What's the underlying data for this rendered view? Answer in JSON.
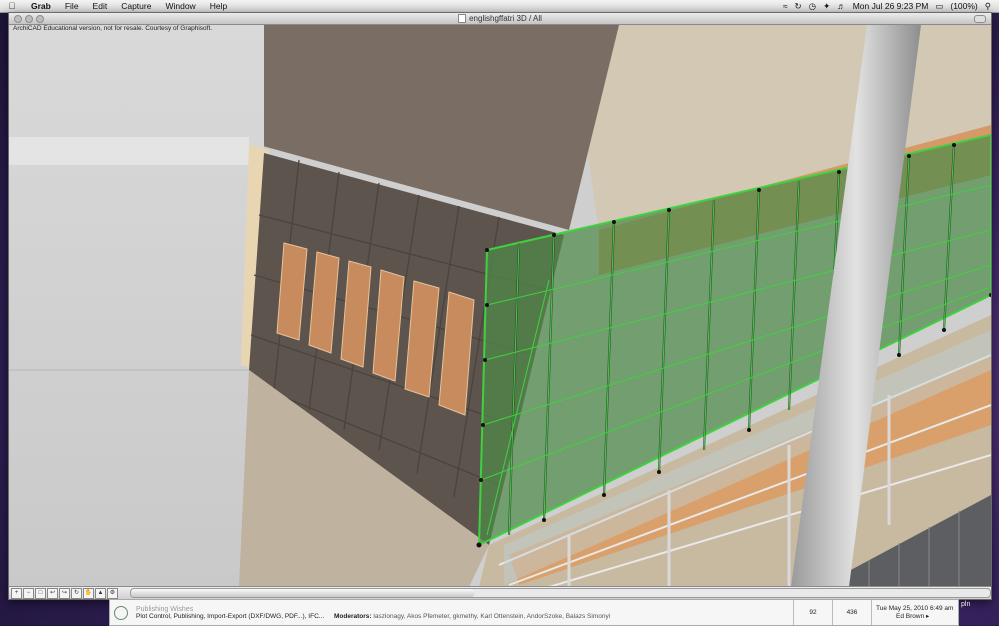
{
  "menubar": {
    "apple_icon": "apple-icon",
    "items": [
      {
        "label": "Grab",
        "bold": true
      },
      {
        "label": "File"
      },
      {
        "label": "Edit"
      },
      {
        "label": "Capture"
      },
      {
        "label": "Window"
      },
      {
        "label": "Help"
      }
    ],
    "battery": "(100%)",
    "clock": "Mon Jul 26  9:23 PM"
  },
  "window": {
    "title": "englishgffatri 3D / All",
    "watermark": "ArchiCAD Educational version, not for resale. Courtesy of Graphisoft."
  },
  "forum": {
    "forum_name": "Publishing Wishes",
    "forum_desc": "Plot Control, Publishing, Import-Export (DXF/DWG, PDF...), IFC...",
    "moderators_label": "Moderators:",
    "moderators": "laszlonagy, Akos Pfemeter, gkmethy, Karl Ottenstein, AndorSzoke, Balazs Simonyi",
    "topics": "92",
    "posts": "436",
    "last_post_date": "Tue May 25, 2010 6:49 am",
    "last_post_author": "Ed Brown"
  },
  "corner_label": "pln",
  "colors": {
    "glass_green": "#3fc93f",
    "wall_beige": "#cbbfa8",
    "shadow_brown": "#6b5f55",
    "orange_interior": "#d9955f"
  }
}
